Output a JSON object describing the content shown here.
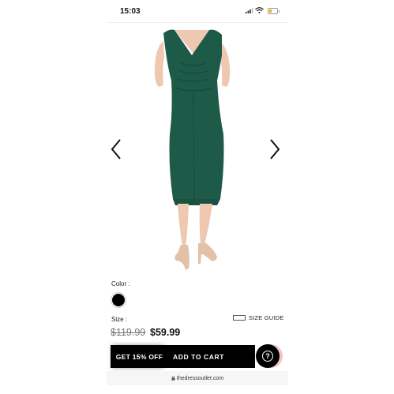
{
  "status_bar": {
    "time": "15:03"
  },
  "product": {
    "color_label": "Color :",
    "selected_color": "#000000",
    "size_label": "Size :",
    "size_guide_label": "SIZE GUIDE",
    "original_price": "$119.99",
    "sale_price": "$59.99",
    "dress_color": "#1e5a48"
  },
  "actions": {
    "add_to_cart_label": "ADD TO CART",
    "promo_label": "GET 15% OFF"
  },
  "browser": {
    "url": "thedressoutlet.com"
  }
}
